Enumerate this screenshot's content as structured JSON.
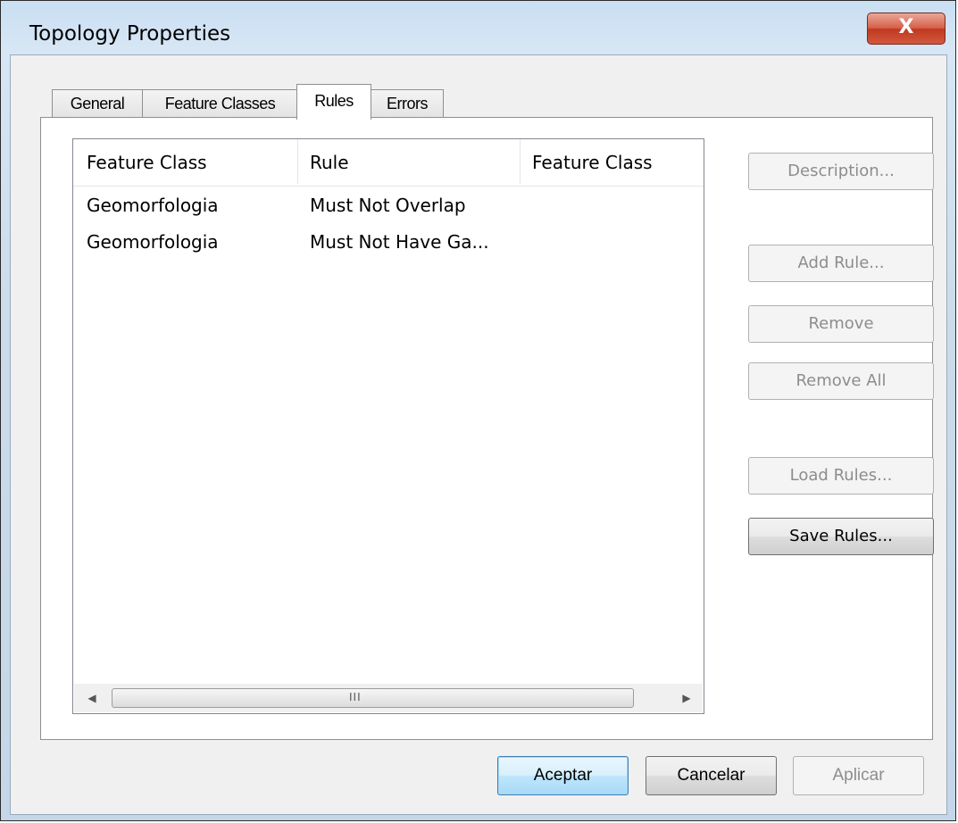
{
  "window": {
    "title": "Topology Properties",
    "close_label": "X"
  },
  "tabs": [
    {
      "label": "General",
      "active": false
    },
    {
      "label": "Feature Classes",
      "active": false
    },
    {
      "label": "Rules",
      "active": true
    },
    {
      "label": "Errors",
      "active": false
    }
  ],
  "rules_list": {
    "columns": [
      "Feature Class",
      "Rule",
      "Feature Class"
    ],
    "rows": [
      {
        "feature_class": "Geomorfologia",
        "rule": "Must Not Overlap",
        "feature_class_2": ""
      },
      {
        "feature_class": "Geomorfologia",
        "rule": "Must Not Have Ga...",
        "feature_class_2": ""
      }
    ],
    "scroll_left_icon": "scroll-left-arrow",
    "scroll_right_icon": "scroll-right-arrow",
    "scroll_grip": "III"
  },
  "side_buttons": {
    "description": "Description...",
    "add_rule": "Add Rule...",
    "remove": "Remove",
    "remove_all": "Remove All",
    "load_rules": "Load Rules...",
    "save_rules": "Save Rules..."
  },
  "footer": {
    "ok": "Aceptar",
    "cancel": "Cancelar",
    "apply": "Aplicar"
  }
}
